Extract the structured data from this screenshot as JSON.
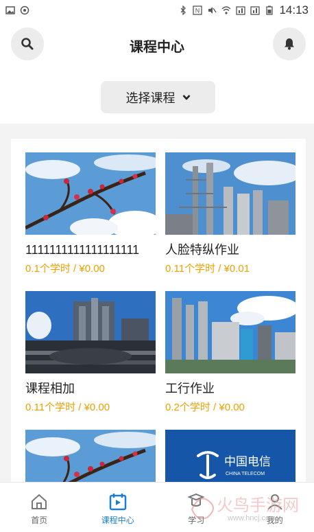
{
  "status_bar": {
    "time": "14:13"
  },
  "header": {
    "title": "课程中心",
    "select_label": "选择课程"
  },
  "courses": [
    {
      "title": "1111111111111111111",
      "meta": "0.1个学时 / ¥0.00",
      "image": "plum-blossom-sky"
    },
    {
      "title": "人脸特纵作业",
      "meta": "0.11个学时 / ¥0.01",
      "image": "industrial-towers"
    },
    {
      "title": "课程相加",
      "meta": "0.11个学时 / ¥0.00",
      "image": "refinery-pipes"
    },
    {
      "title": "工行作业",
      "meta": "0.2个学时 / ¥0.00",
      "image": "smokestacks-plant"
    },
    {
      "title": "",
      "meta": "",
      "image": "plum-blossom-sky"
    },
    {
      "title": "",
      "meta": "",
      "image": "china-telecom-logo",
      "logo_text": "中国电信",
      "logo_sub": "CHINA TELECOM"
    }
  ],
  "bottom_nav": [
    {
      "label": "首页",
      "icon": "home-icon"
    },
    {
      "label": "课程中心",
      "icon": "calendar-play-icon"
    },
    {
      "label": "学习",
      "icon": "study-icon"
    },
    {
      "label": "我的",
      "icon": "user-icon"
    }
  ],
  "watermark": {
    "text": "火鸟手游网",
    "url": "www.hncj.com"
  },
  "colors": {
    "accent": "#1a7fd4",
    "price": "#f0a000",
    "telecom_blue": "#1656a8"
  }
}
